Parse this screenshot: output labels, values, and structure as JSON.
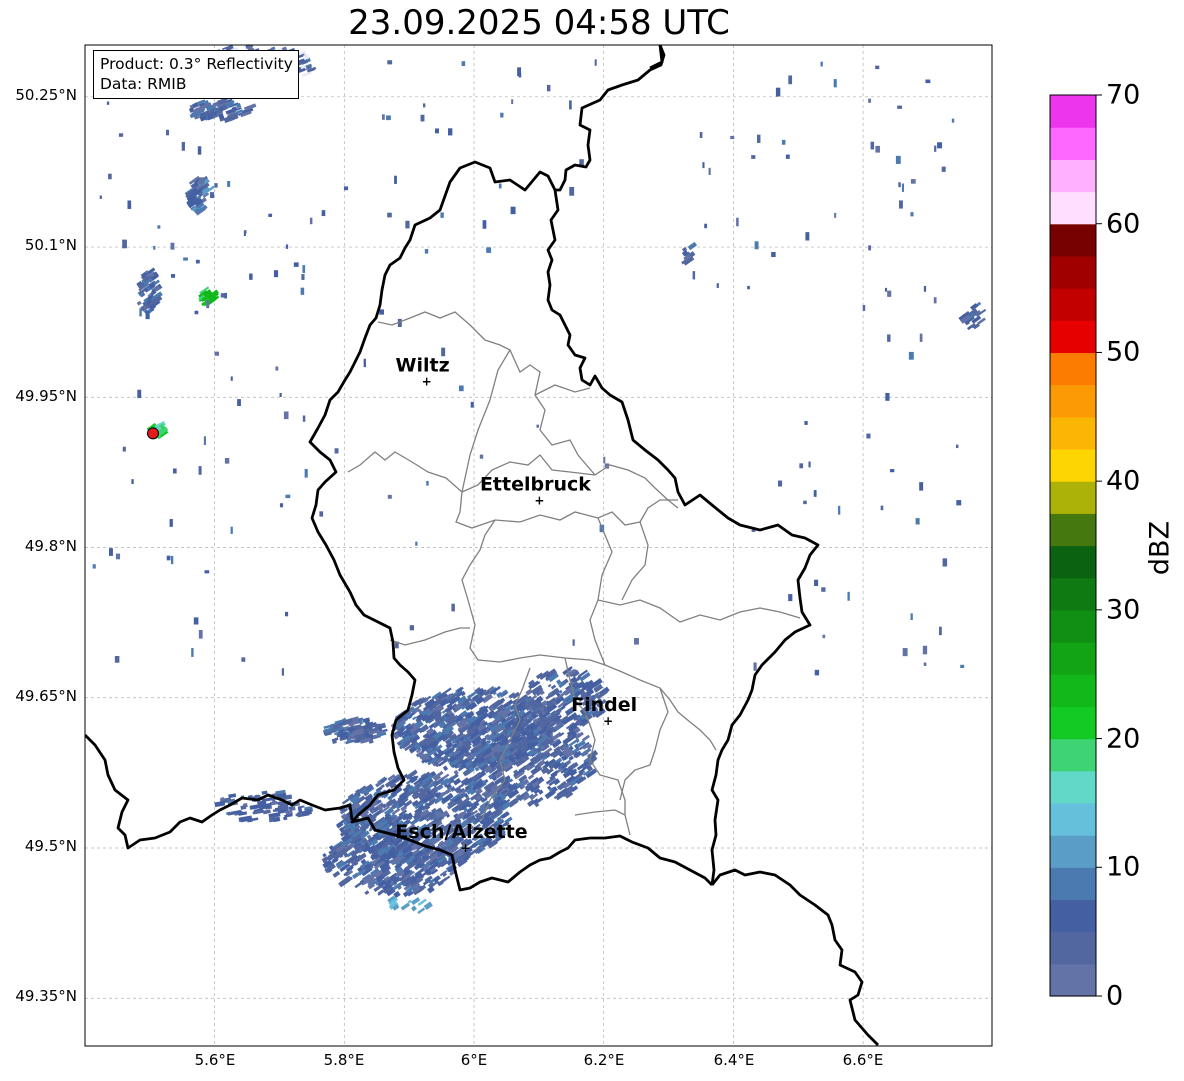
{
  "title": "23.09.2025 04:58 UTC",
  "info": {
    "product": "Product: 0.3° Reflectivity",
    "data": "Data: RMIB"
  },
  "lat_labels": [
    "50.25°N",
    "50.1°N",
    "49.95°N",
    "49.8°N",
    "49.65°N",
    "49.5°N",
    "49.35°N"
  ],
  "lon_labels": [
    "5.6°E",
    "5.8°E",
    "6°E",
    "6.2°E",
    "6.4°E",
    "6.6°E"
  ],
  "cities": [
    {
      "name": "Wiltz",
      "lon": 5.93,
      "lat": 49.966
    },
    {
      "name": "Ettelbruck",
      "lon": 6.104,
      "lat": 49.847
    },
    {
      "name": "Findel",
      "lon": 6.21,
      "lat": 49.627
    },
    {
      "name": "Esch/Alzette",
      "lon": 5.99,
      "lat": 49.5
    }
  ],
  "radar_site": {
    "lon": 5.505,
    "lat": 49.914,
    "color": "#e31a1c"
  },
  "colorbar": {
    "label": "dBZ",
    "min": 0,
    "max": 70,
    "step": 2.5,
    "ticks": [
      "0",
      "10",
      "20",
      "30",
      "40",
      "50",
      "60",
      "70"
    ],
    "colors": [
      "#6473a7",
      "#5267a0",
      "#4460a2",
      "#4b7ab1",
      "#5a9ec8",
      "#65c0dc",
      "#62d8c8",
      "#3fd473",
      "#13c924",
      "#12b81a",
      "#12a415",
      "#118e14",
      "#0e7a11",
      "#0b6311",
      "#45780e",
      "#adb208",
      "#fdd500",
      "#fbb605",
      "#fb9a04",
      "#fc7c02",
      "#e60000",
      "#c20000",
      "#a10000",
      "#770000",
      "#ffdfff",
      "#ffb0ff",
      "#ff68ff",
      "#ed35ed"
    ]
  },
  "legend_colors": {
    "border_country": "#000000",
    "border_canton": "#808080",
    "grid": "#b0b0b0"
  }
}
